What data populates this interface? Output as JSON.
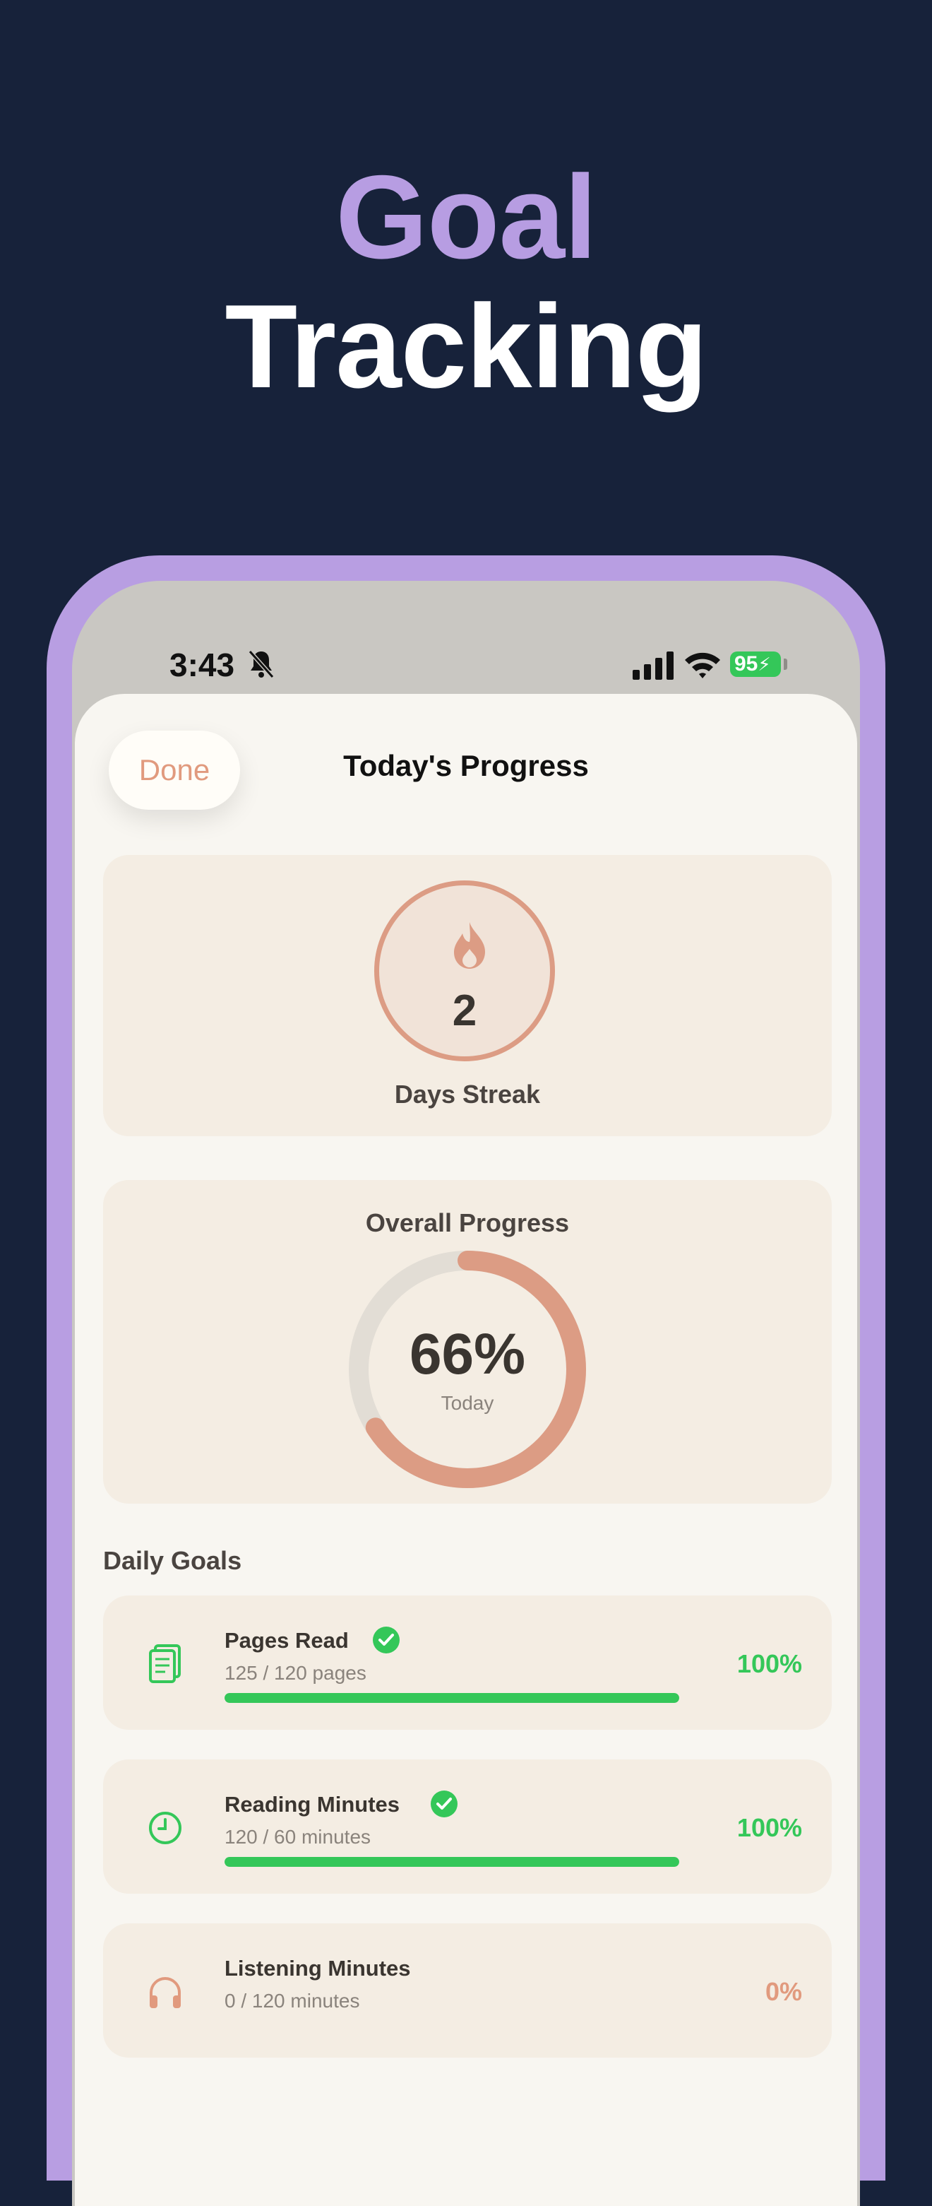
{
  "headline": {
    "line1": "Goal",
    "line2": "Tracking"
  },
  "status_bar": {
    "time": "3:43",
    "battery": "95"
  },
  "sheet": {
    "done_label": "Done",
    "title": "Today's Progress"
  },
  "streak": {
    "value": "2",
    "label": "Days Streak"
  },
  "overall": {
    "title": "Overall Progress",
    "percent": "66%",
    "subtitle": "Today",
    "progress": 0.66
  },
  "daily_goals": {
    "section_label": "Daily Goals",
    "items": [
      {
        "name": "Pages Read",
        "detail": "125 / 120 pages",
        "percent": "100%",
        "progress": 1.0,
        "completed": true,
        "icon": "book-pages-icon"
      },
      {
        "name": "Reading Minutes",
        "detail": "120 / 60 minutes",
        "percent": "100%",
        "progress": 1.0,
        "completed": true,
        "icon": "clock-icon"
      },
      {
        "name": "Listening Minutes",
        "detail": "0 / 120 minutes",
        "percent": "0%",
        "progress": 0.0,
        "completed": false,
        "icon": "headphones-icon"
      }
    ]
  },
  "colors": {
    "accent": "#e19a7e",
    "success": "#34c759",
    "brand_purple": "#b79de2",
    "background": "#17223a"
  }
}
